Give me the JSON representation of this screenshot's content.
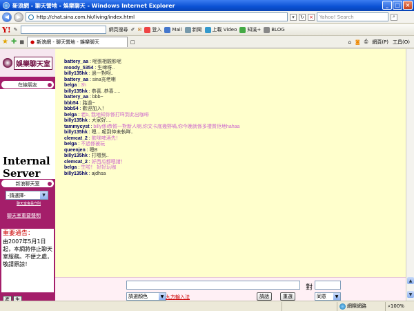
{
  "window": {
    "title": "新浪網 - 聊天營地 - 娛樂聊天 - Windows Internet Explorer"
  },
  "address": {
    "url": "http://chat.sina.com.hk/living/index.html",
    "search_placeholder": "Yahoo! Search"
  },
  "ytoolbar": {
    "logo": "Y!",
    "search_button": "網頁搜尋",
    "items": [
      "登入",
      "Mail",
      "新聞",
      "上載 Video",
      "知識+",
      "BLOG"
    ]
  },
  "tabs": {
    "active": "新浪網 - 聊天營地 - 娛樂聊天",
    "page_menu": "網頁(P)",
    "tools_menu": "工具(O)"
  },
  "sidebar": {
    "logo_text": "娛樂聊天室",
    "online_friends": "在線朋友",
    "server_text": "Internal Server",
    "room_bar": "新浪聊天室",
    "room_select": "-請選擇-",
    "rules_link": "聊天室會員守則",
    "disclaimer_link": "聊天室重要聲明",
    "notice_title": "重要通告：",
    "notice_body": "由2007年5月1日起，本網將停止聊天室服務。不便之處，敬請原諒！"
  },
  "chat": {
    "messages": [
      {
        "nick": "battery_aa",
        "text": "呢張相靚影呢",
        "color": "#333333"
      },
      {
        "nick": "moody_5354",
        "text": "生啤呀..",
        "color": "#333333"
      },
      {
        "nick": "billy135hk",
        "text": "過一對呀..",
        "color": "#333333"
      },
      {
        "nick": "battery_aa",
        "text": "sina充老喇",
        "color": "#333333"
      },
      {
        "nick": "belga",
        "text": "3h",
        "color": "#cc66cc"
      },
      {
        "nick": "billy135hk",
        "text": "恭喜..恭喜.....",
        "color": "#333333"
      },
      {
        "nick": "battery_aa",
        "text": "bbb~",
        "color": "#333333"
      },
      {
        "nick": "bbb54",
        "text": "路過~",
        "color": "#333333"
      },
      {
        "nick": "bbb54",
        "text": "歡迎加入！",
        "color": "#333333"
      },
      {
        "nick": "belga",
        "text": "老b, 我地知你係打咩到此出咖啡",
        "color": "#cc66cc"
      },
      {
        "nick": "billy135hk",
        "text": "大家好....",
        "color": "#333333"
      },
      {
        "nick": "tammycyst",
        "text": "billy係i恭賀一對新人喇,你文卡底幾野喎,你今晚就係多禮質佢地hahaa",
        "color": "#cc66cc"
      },
      {
        "nick": "billy135hk",
        "text": "嗯....呢到仲未執咩..",
        "color": "#333333"
      },
      {
        "nick": "clemcat_2",
        "text": "飲咪啤酒先！",
        "color": "#cc66cc"
      },
      {
        "nick": "belga",
        "text": "不過係被玩",
        "color": "#cc66cc"
      },
      {
        "nick": "queenjen",
        "text": "嗯B",
        "color": "#333333"
      },
      {
        "nick": "billy135hk",
        "text": "打嗯到..",
        "color": "#333333"
      },
      {
        "nick": "clemcat_2",
        "text": "好西瓜都嗯諸！",
        "color": "#cc66cc"
      },
      {
        "nick": "belga",
        "text": "生啦！ 好好玩咖",
        "color": "#cc66cc"
      },
      {
        "nick": "billy135hk",
        "text": "ajdhsa",
        "color": "#333333"
      }
    ]
  },
  "input": {
    "to_label": "對",
    "color_select": "請選顏色",
    "ninegrid_link": "九方輸入法",
    "send_button": "請話",
    "clear_button": "重選",
    "mood_select": "同意"
  },
  "corner": {
    "b1": "產",
    "b2": "生"
  },
  "status": {
    "zone": "網際網路",
    "zoom": "100%"
  },
  "colors": {
    "sidebar": "#a41e6a",
    "chat_bg": "#ffffcc",
    "nick": "#000066"
  }
}
